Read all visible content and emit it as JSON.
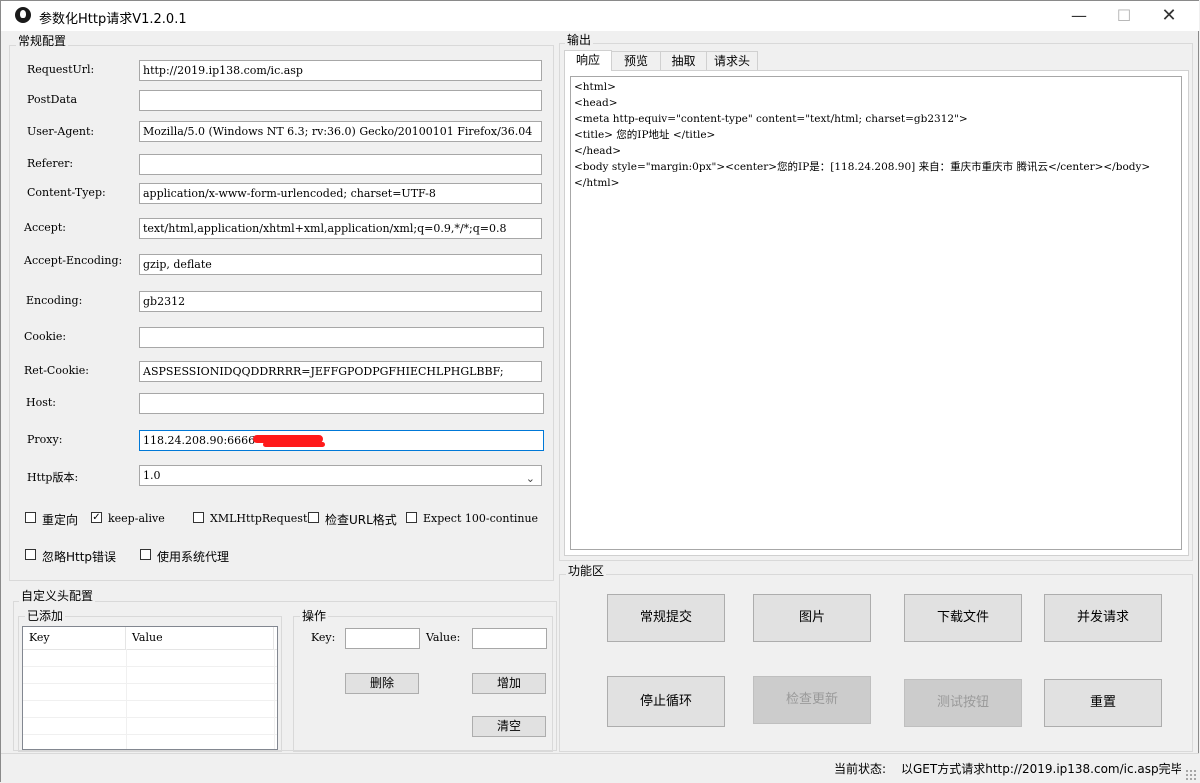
{
  "window": {
    "title": "参数化Http请求V1.2.0.1",
    "min_glyph": "—",
    "max_glyph": "☐",
    "close_glyph": "✕"
  },
  "general": {
    "group_title": "常规配置",
    "fields": {
      "request_url": {
        "label": "RequestUrl:",
        "value": "http://2019.ip138.com/ic.asp"
      },
      "post_data": {
        "label": "PostData",
        "value": ""
      },
      "user_agent": {
        "label": "User-Agent:",
        "value": "Mozilla/5.0 (Windows NT 6.3; rv:36.0) Gecko/20100101 Firefox/36.04"
      },
      "referer": {
        "label": "Referer:",
        "value": ""
      },
      "content_type": {
        "label": "Content-Tyep:",
        "value": "application/x-www-form-urlencoded; charset=UTF-8"
      },
      "accept": {
        "label": "Accept:",
        "value": "text/html,application/xhtml+xml,application/xml;q=0.9,*/*;q=0.8"
      },
      "accept_encoding": {
        "label": "Accept-Encoding:",
        "value": "gzip, deflate"
      },
      "encoding": {
        "label": "Encoding:",
        "value": "gb2312"
      },
      "cookie": {
        "label": "Cookie:",
        "value": ""
      },
      "ret_cookie": {
        "label": "Ret-Cookie:",
        "value": "ASPSESSIONIDQQDDRRRR=JEFFGPODPGFHIECHLPHGLBBF;"
      },
      "host": {
        "label": "Host:",
        "value": ""
      },
      "proxy": {
        "label": "Proxy:",
        "value": "118.24.208.90:6666"
      },
      "http_version": {
        "label": "Http版本:",
        "value": "1.0"
      }
    },
    "checkboxes": {
      "redirect": {
        "label": "重定向",
        "checked": false
      },
      "keep_alive": {
        "label": "keep-alive",
        "checked": true
      },
      "xml_http_request": {
        "label": "XMLHttpRequest",
        "checked": false
      },
      "check_url": {
        "label": "检查URL格式",
        "checked": false
      },
      "expect_100": {
        "label": "Expect 100-continue",
        "checked": false
      },
      "ignore_http_error": {
        "label": "忽略Http错误",
        "checked": false
      },
      "use_system_proxy": {
        "label": "使用系统代理",
        "checked": false
      }
    },
    "check_glyph": "✓"
  },
  "custom_headers": {
    "group_title": "自定义头配置",
    "added_title": "已添加",
    "columns": [
      "Key",
      "Value"
    ],
    "ops_title": "操作",
    "key_label": "Key:",
    "value_label": "Value:",
    "key_value": "",
    "value_value": "",
    "delete_label": "删除",
    "add_label": "增加",
    "clear_label": "清空"
  },
  "output": {
    "group_title": "输出",
    "tabs": [
      "响应",
      "预览",
      "抽取",
      "请求头"
    ],
    "active_tab": "响应",
    "response_text": "<html>\n<head>\n<meta http-equiv=\"content-type\" content=\"text/html; charset=gb2312\">\n<title> 您的IP地址 </title>\n</head>\n<body style=\"margin:0px\"><center>您的IP是：[118.24.208.90] 来自：重庆市重庆市 腾讯云</center></body>\n</html>"
  },
  "functions": {
    "group_title": "功能区",
    "buttons": {
      "submit": {
        "label": "常规提交",
        "enabled": true
      },
      "image": {
        "label": "图片",
        "enabled": true
      },
      "download": {
        "label": "下载文件",
        "enabled": true
      },
      "concurrent": {
        "label": "并发请求",
        "enabled": true
      },
      "stop_loop": {
        "label": "停止循环",
        "enabled": true
      },
      "check_update": {
        "label": "检查更新",
        "enabled": false
      },
      "test_button": {
        "label": "测试按钮",
        "enabled": false
      },
      "reset": {
        "label": "重置",
        "enabled": true
      }
    }
  },
  "status": {
    "label": "当前状态:",
    "value": "以GET方式请求http://2019.ip138.com/ic.asp完毕"
  },
  "colors": {
    "focus_border": "#0078d7",
    "redaction": "#ff1a1a",
    "disabled_text": "#9a9a9a"
  }
}
